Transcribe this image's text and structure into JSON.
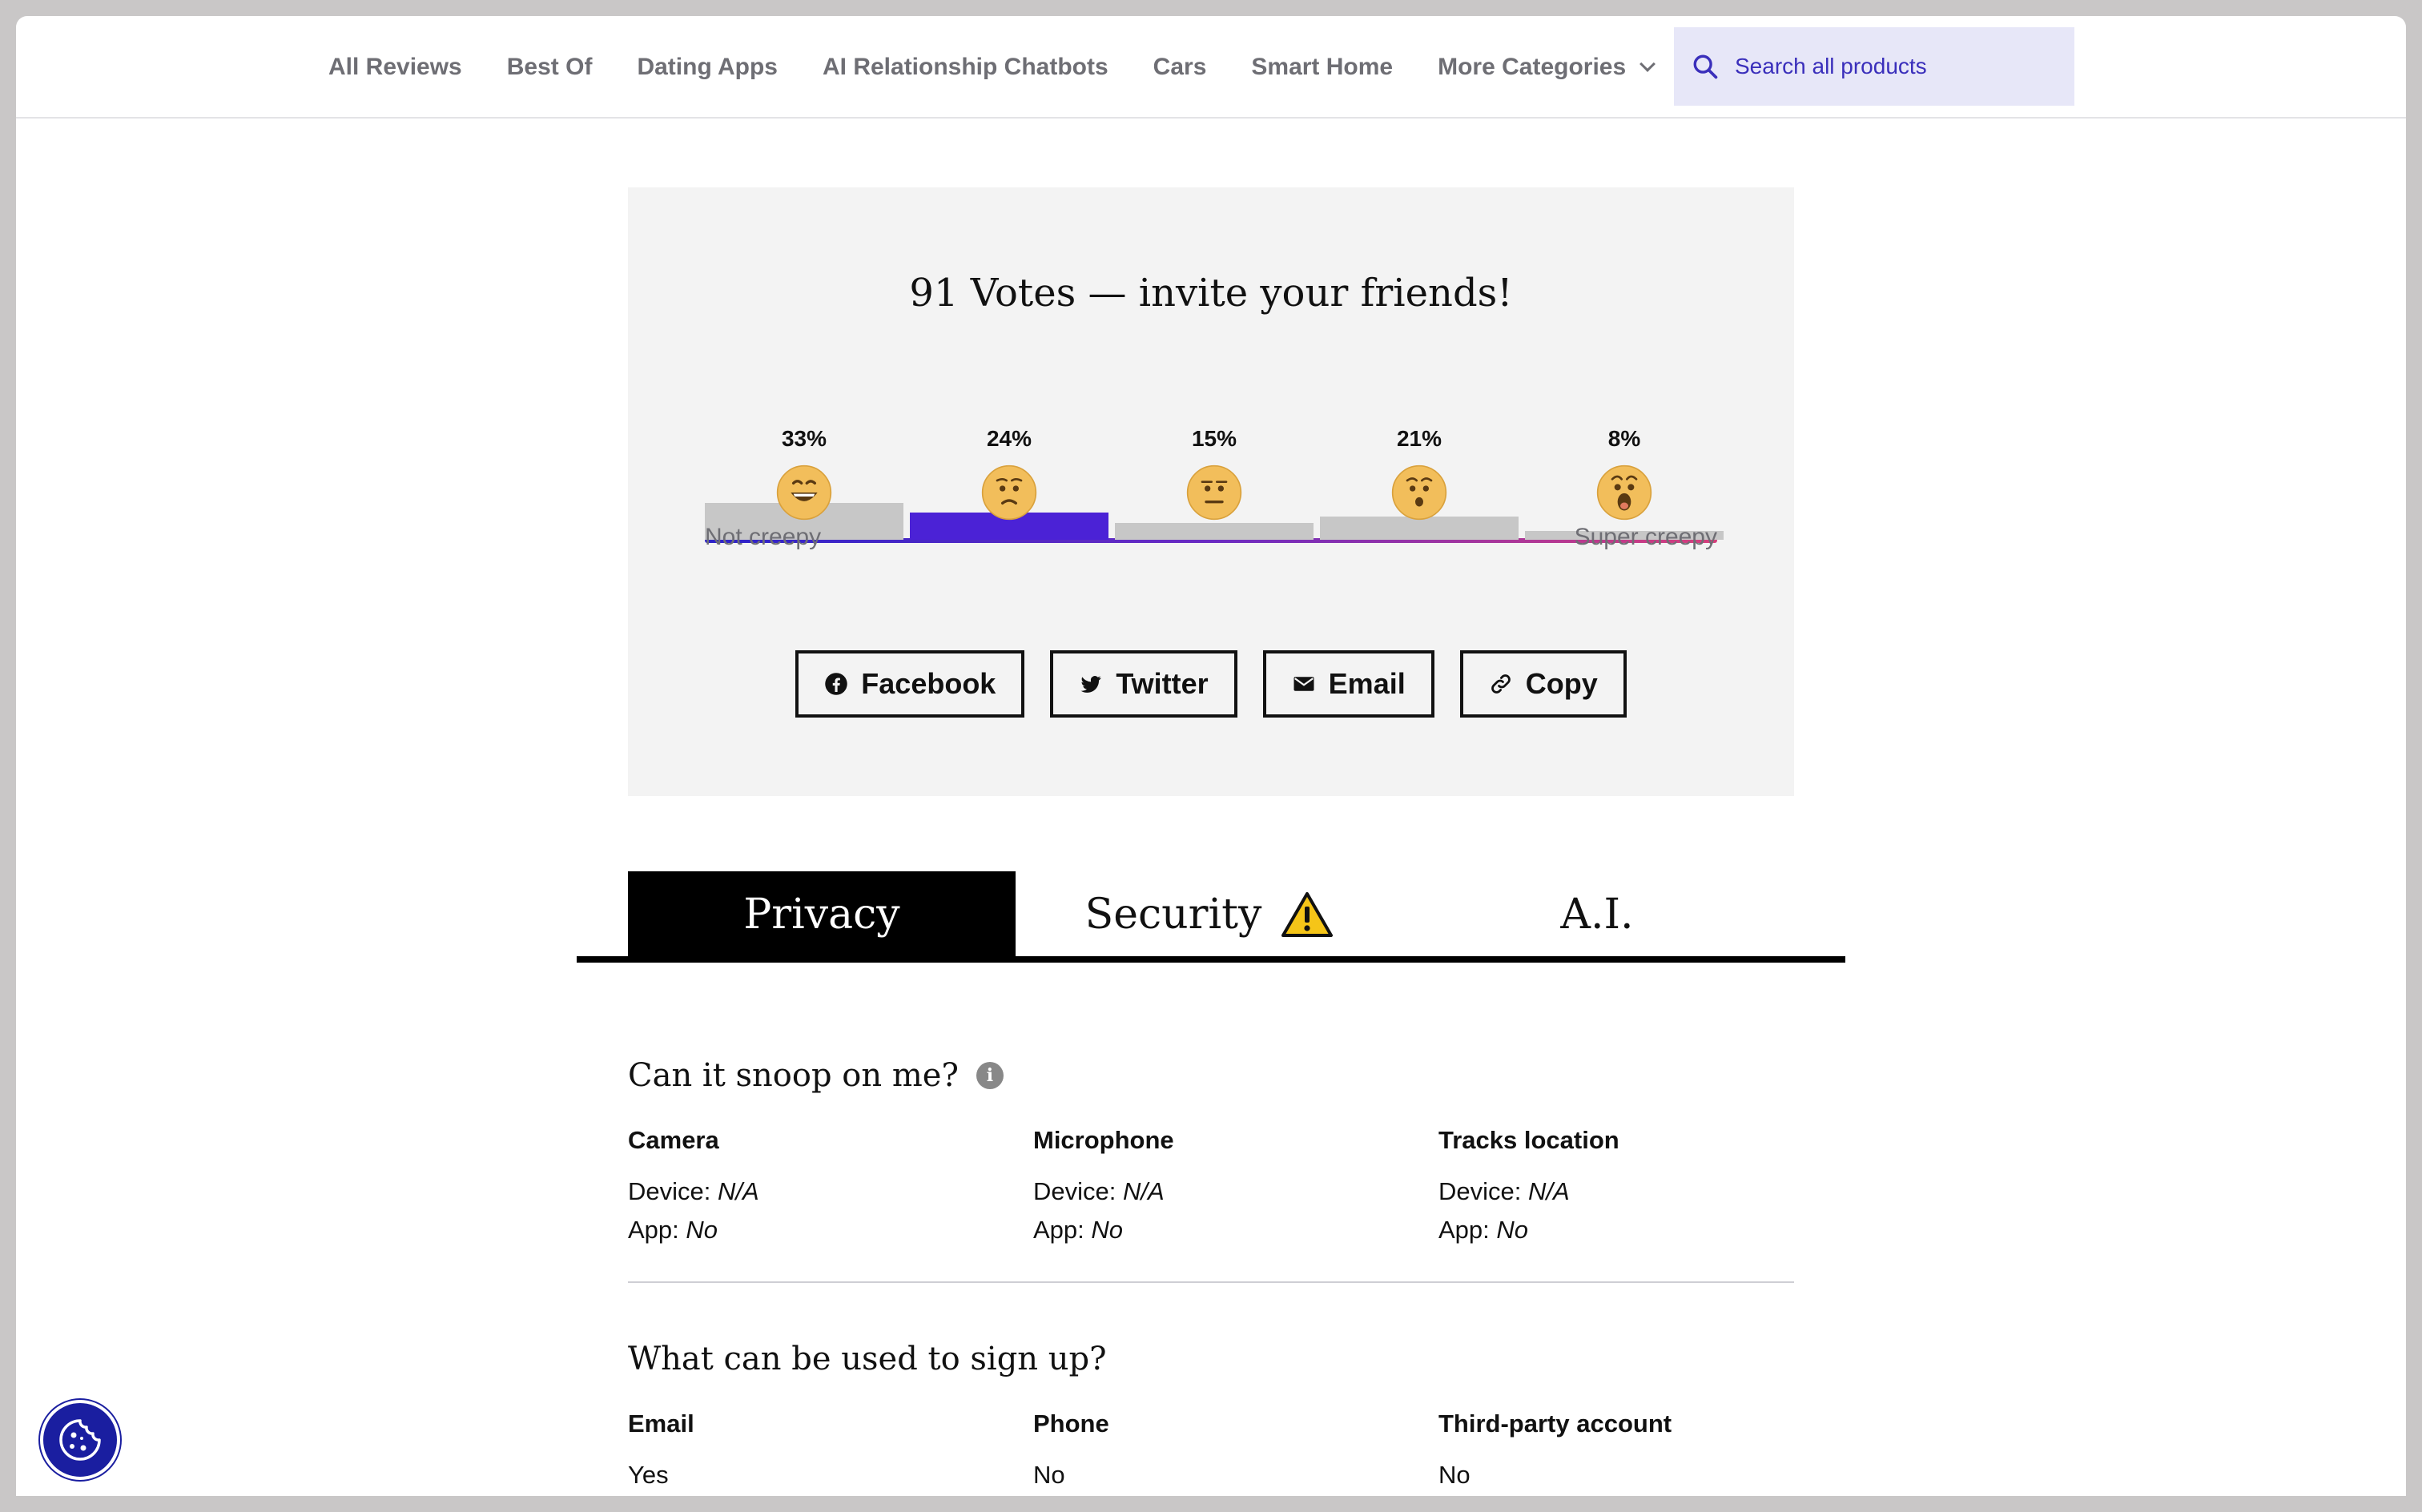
{
  "nav": {
    "links": [
      "All Reviews",
      "Best Of",
      "Dating Apps",
      "AI Relationship Chatbots",
      "Cars",
      "Smart Home"
    ],
    "more_label": "More Categories",
    "search_placeholder": "Search all products"
  },
  "vote": {
    "title": "91 Votes — invite your friends!",
    "min_label": "Not creepy",
    "max_label": "Super creepy",
    "selected_index": 1,
    "levels": [
      {
        "label": "33%",
        "value": 33,
        "face": "grinning-face-icon"
      },
      {
        "label": "24%",
        "value": 24,
        "face": "slightly-worried-face-icon"
      },
      {
        "label": "15%",
        "value": 15,
        "face": "neutral-face-icon"
      },
      {
        "label": "21%",
        "value": 21,
        "face": "hushed-face-icon"
      },
      {
        "label": "8%",
        "value": 8,
        "face": "shocked-face-icon"
      }
    ],
    "colors": {
      "bar": "#c7c7c7",
      "selected_bar": "#4b22d6"
    }
  },
  "share": {
    "facebook": "Facebook",
    "twitter": "Twitter",
    "email": "Email",
    "copy": "Copy"
  },
  "tabs": {
    "privacy": "Privacy",
    "security": "Security",
    "ai": "A.I.",
    "active": "privacy"
  },
  "snoop": {
    "heading": "Can it snoop on me?",
    "info_glyph": "i",
    "columns": [
      {
        "title": "Camera",
        "device_label": "Device:",
        "device_value": "N/A",
        "app_label": "App:",
        "app_value": "No"
      },
      {
        "title": "Microphone",
        "device_label": "Device:",
        "device_value": "N/A",
        "app_label": "App:",
        "app_value": "No"
      },
      {
        "title": "Tracks location",
        "device_label": "Device:",
        "device_value": "N/A",
        "app_label": "App:",
        "app_value": "No"
      }
    ]
  },
  "signup": {
    "heading": "What can be used to sign up?",
    "columns": [
      {
        "title": "Email",
        "value": "Yes"
      },
      {
        "title": "Phone",
        "value": "No"
      },
      {
        "title": "Third-party account",
        "value": "No"
      }
    ]
  }
}
